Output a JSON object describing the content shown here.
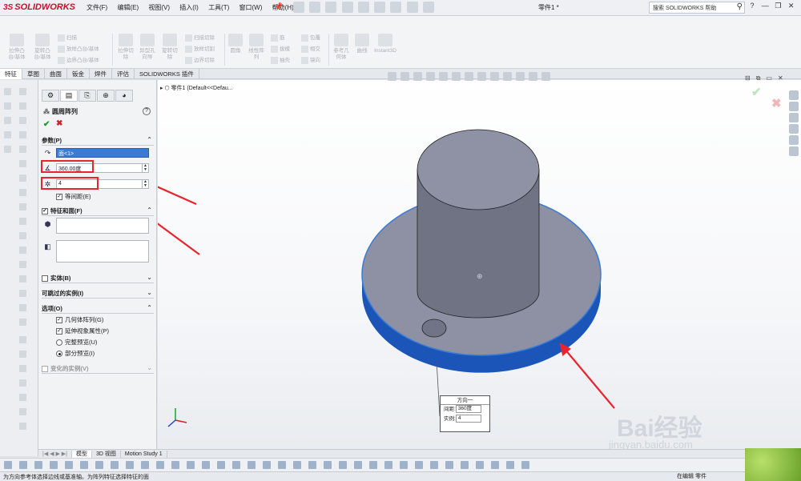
{
  "app": {
    "logo": "SOLIDWORKS",
    "brand_prefix": "3S",
    "doc_title": "零件1 *"
  },
  "menu": [
    "文件(F)",
    "编辑(E)",
    "视图(V)",
    "插入(I)",
    "工具(T)",
    "窗口(W)",
    "帮助(H)"
  ],
  "search": {
    "placeholder": "搜索 SOLIDWORKS 帮助"
  },
  "ribbon": {
    "big": [
      {
        "label": "拉伸凸\n台/基体"
      },
      {
        "label": "旋转凸\n台/基体"
      },
      {
        "label": "拉伸切\n除"
      },
      {
        "label": "异型孔\n向导"
      },
      {
        "label": "旋转切\n除"
      },
      {
        "label": "圆角"
      },
      {
        "label": "线性阵\n列"
      },
      {
        "label": "参考几\n何体"
      },
      {
        "label": "曲线"
      },
      {
        "label": "Instant3D"
      }
    ],
    "small": [
      "扫描",
      "放样凸台/基体",
      "边界凸台/基体",
      "扫描切除",
      "放样切割",
      "边界切除",
      "筋",
      "拔模",
      "抽壳",
      "包覆",
      "相交",
      "镜向"
    ]
  },
  "tabs": [
    "特征",
    "草图",
    "曲面",
    "钣金",
    "焊件",
    "评估",
    "SOLIDWORKS 插件"
  ],
  "feature": {
    "title": "圆周阵列",
    "sections": {
      "params": "参数(P)",
      "features_faces": "特征和面(F)",
      "bodies": "实体(B)",
      "skip": "可跳过的实例(I)",
      "options": "选项(O)",
      "varied": "变化的实例(V)"
    },
    "axis_value": "面<1>",
    "angle_value": "360.00度",
    "count_value": "4",
    "equal_spacing": "等间距(E)",
    "geometry_pattern": "几何体阵列(G)",
    "propagate": "延伸视象属性(P)",
    "full_preview": "完整预览(U)",
    "partial_preview": "部分预览(I)"
  },
  "tree": {
    "root": "零件1  (Default<<Defau..."
  },
  "callout": {
    "title": "方向一",
    "spacing_label": "间距:",
    "spacing_value": "360度",
    "count_label": "实例:",
    "count_value": "4"
  },
  "bottom_tabs": [
    "模型",
    "3D 视图",
    "Motion Study 1"
  ],
  "status": {
    "message": "为方向参考体选择边线或基准轴。为阵列特征选择特征的面",
    "mode": "在编辑 零件"
  },
  "watermark": {
    "text": "Bai经验",
    "url": "jingyan.baidu.com"
  },
  "colors": {
    "accent": "#3a7bd5",
    "part_gray": "#8d91a3",
    "rim_blue": "#1c55b8",
    "arrow_red": "#e8252e"
  }
}
